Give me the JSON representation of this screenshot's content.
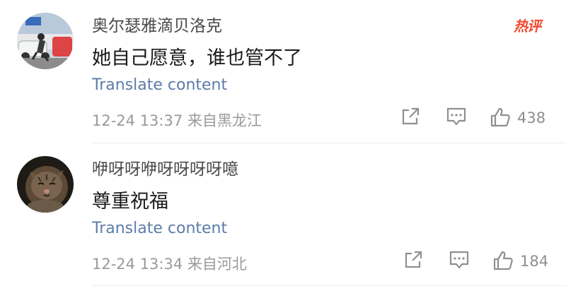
{
  "comments": [
    {
      "username": "奥尔瑟雅滴贝洛克",
      "content": "她自己愿意，谁也管不了",
      "translate_label": "Translate content",
      "meta": "12-24 13:37 来自黑龙江",
      "likes": "438",
      "badge": "热评"
    },
    {
      "username": "咿呀呀咿呀呀呀呀噫",
      "content": "尊重祝福",
      "translate_label": "Translate content",
      "meta": "12-24 13:34 来自河北",
      "likes": "184"
    }
  ],
  "colors": {
    "link": "#5b7ca8",
    "badge": "#f24a2e",
    "icon": "#8f8f8f"
  },
  "icons": [
    "share-icon",
    "comment-icon",
    "like-icon"
  ]
}
